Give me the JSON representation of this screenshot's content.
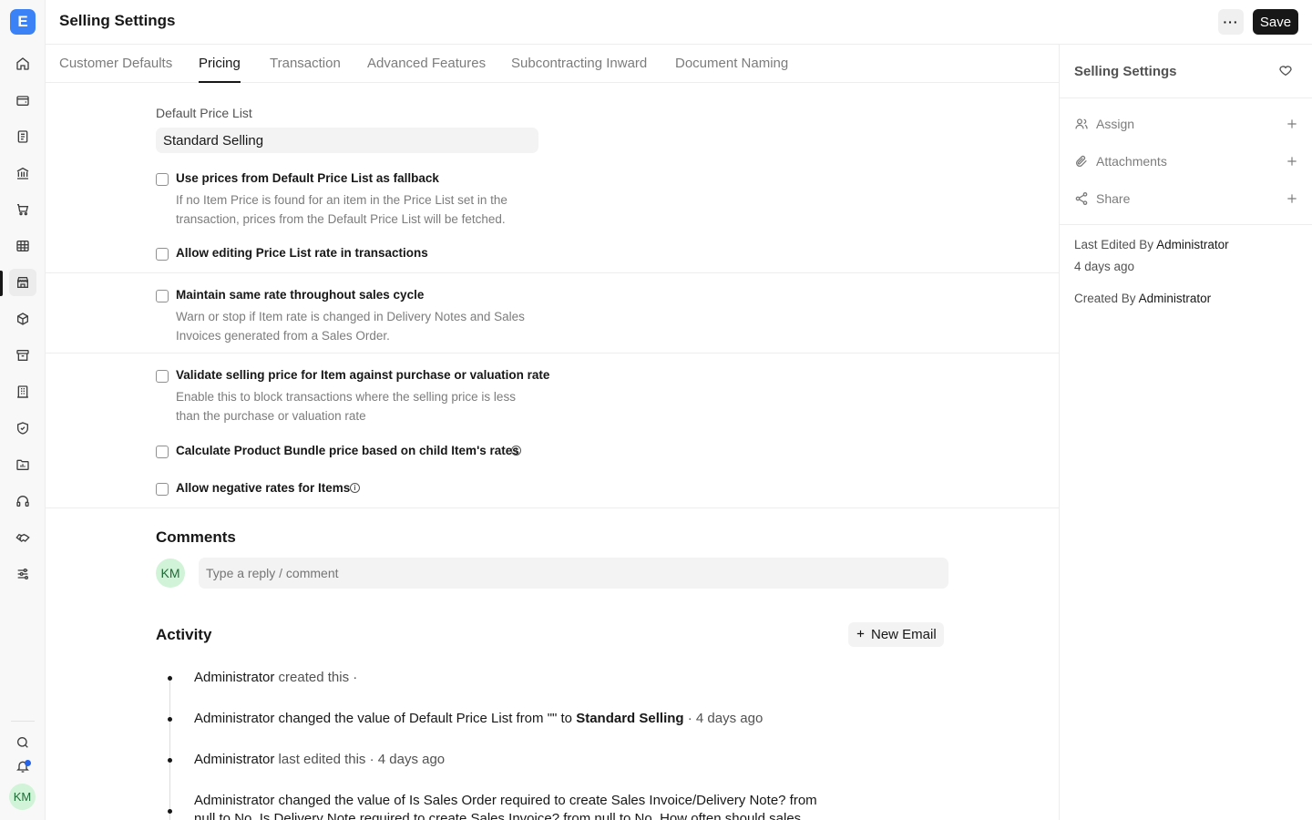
{
  "app": {
    "logo_letter": "E",
    "page_title": "Selling Settings",
    "more_label": "···",
    "save_label": "Save",
    "user_initials": "KM"
  },
  "rail": {
    "icons": [
      "home-icon",
      "wallet-icon",
      "file-text-icon",
      "bank-icon",
      "cart-icon",
      "table-icon",
      "store-icon",
      "package-icon",
      "archive-icon",
      "building-icon",
      "shield-icon",
      "folder-chart-icon",
      "headset-icon",
      "handshake-icon",
      "sliders-icon",
      "search-icon",
      "bell-icon"
    ],
    "active": "store-icon"
  },
  "tabs": [
    "Customer Defaults",
    "Pricing",
    "Transaction",
    "Advanced Features",
    "Subcontracting Inward",
    "Document Naming"
  ],
  "active_tab": "Pricing",
  "form": {
    "default_price_list_label": "Default Price List",
    "default_price_list_value": "Standard Selling",
    "fallback": {
      "label": "Use prices from Default Price List as fallback",
      "desc": "If no Item Price is found for an item in the Price List set in the transaction, prices from the Default Price List will be fetched.",
      "checked": false
    },
    "allow_edit_rate": {
      "label": "Allow editing Price List rate in transactions",
      "checked": false
    },
    "maintain_rate": {
      "label": "Maintain same rate throughout sales cycle",
      "desc": "Warn or stop if Item rate is changed in Delivery Notes and Sales Invoices generated from a Sales Order.",
      "checked": false
    },
    "validate_selling": {
      "label": "Validate selling price for Item against purchase or valuation rate",
      "desc": "Enable this to block transactions where the selling price is less than the purchase or valuation rate",
      "checked": false
    },
    "bundle_price": {
      "label": "Calculate Product Bundle price based on child Item's rates",
      "checked": false
    },
    "negative_rates": {
      "label": "Allow negative rates for Items",
      "checked": false
    },
    "info_glyph": "i"
  },
  "comments": {
    "heading": "Comments",
    "avatar": "KM",
    "placeholder": "Type a reply / comment"
  },
  "activity": {
    "heading": "Activity",
    "new_email_label": "New Email",
    "items": {
      "a1": {
        "user": "Administrator",
        "action": "created this ·"
      },
      "a2": {
        "user": "Administrator",
        "pre": "changed the value of Default Price List from \"\" to",
        "value": "Standard Selling",
        "time": "· 4 days ago"
      },
      "a3": {
        "user": "Administrator",
        "action": "last edited this · 4 days ago"
      },
      "a4": {
        "line1": "Administrator changed the value of Is Sales Order required to create Sales Invoice/Delivery Note? from",
        "line2": "null to No, Is Delivery Note required to create Sales Invoice? from null to No, How often should sales"
      }
    }
  },
  "sidebar": {
    "title": "Selling Settings",
    "assign_label": "Assign",
    "attachments_label": "Attachments",
    "share_label": "Share",
    "last_edited_prefix": "Last Edited By",
    "last_edited_by": "Administrator",
    "last_edited_time": "4 days ago",
    "created_prefix": "Created By",
    "created_by": "Administrator"
  }
}
